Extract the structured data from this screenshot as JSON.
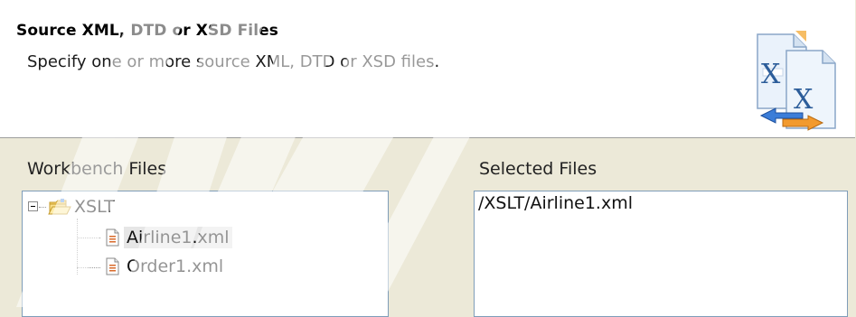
{
  "header": {
    "title": "Source XML, DTD or XSD Files",
    "description": "Specify one or more source XML, DTD or XSD files."
  },
  "workbench": {
    "label": "Workbench Files",
    "root": {
      "label": "XSLT"
    },
    "children": [
      {
        "label": "Airline1.xml",
        "selected": true
      },
      {
        "label": "Order1.xml",
        "selected": false
      }
    ]
  },
  "selected_files": {
    "label": "Selected Files",
    "items": [
      "/XSLT/Airline1.xml"
    ]
  },
  "icons": {
    "wizard": "xml-conversion-icon",
    "expander": "collapse-icon",
    "folder": "open-folder-icon",
    "file": "xml-file-icon"
  }
}
